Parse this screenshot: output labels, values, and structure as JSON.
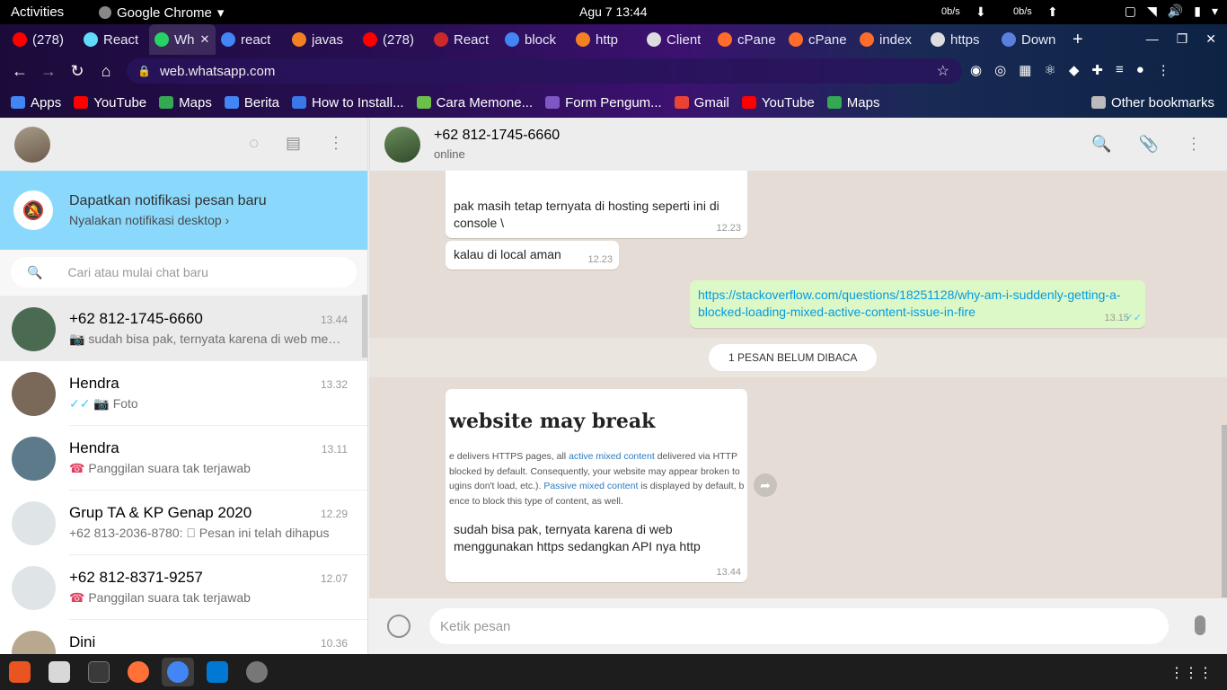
{
  "topbar": {
    "activities": "Activities",
    "app_name": "Google Chrome",
    "clock": "Agu 7  13:44",
    "net_down": "0b/s",
    "net_up": "0b/s"
  },
  "chrome": {
    "tabs": [
      {
        "label": "(278)",
        "color": "#ff0000"
      },
      {
        "label": "React",
        "color": "#61dafb"
      },
      {
        "label": "Wh",
        "color": "#25d366",
        "active": true
      },
      {
        "label": "react",
        "color": "#4285f4"
      },
      {
        "label": "javas",
        "color": "#f48024"
      },
      {
        "label": "(278)",
        "color": "#ff0000"
      },
      {
        "label": "React",
        "color": "#cc2a2a"
      },
      {
        "label": "block",
        "color": "#4285f4"
      },
      {
        "label": "http",
        "color": "#f48024"
      },
      {
        "label": "Client",
        "color": "#dddddd"
      },
      {
        "label": "cPane",
        "color": "#ff6c2c"
      },
      {
        "label": "cPane",
        "color": "#ff6c2c"
      },
      {
        "label": "index",
        "color": "#ff6c2c"
      },
      {
        "label": "https",
        "color": "#dddddd"
      },
      {
        "label": "Down",
        "color": "#5a7fdc"
      }
    ],
    "url": "web.whatsapp.com",
    "bookmarks": [
      {
        "label": "Apps",
        "color": "#4285f4"
      },
      {
        "label": "YouTube",
        "color": "#ff0000"
      },
      {
        "label": "Maps",
        "color": "#34a853"
      },
      {
        "label": "Berita",
        "color": "#4285f4"
      },
      {
        "label": "How to Install...",
        "color": "#3b78e7"
      },
      {
        "label": "Cara Memone...",
        "color": "#6cc04a"
      },
      {
        "label": "Form Pengum...",
        "color": "#7e57c2"
      },
      {
        "label": "Gmail",
        "color": "#ea4335"
      },
      {
        "label": "YouTube",
        "color": "#ff0000"
      },
      {
        "label": "Maps",
        "color": "#34a853"
      }
    ],
    "other_bookmarks": "Other bookmarks"
  },
  "sidebar": {
    "notif_title": "Dapatkan notifikasi pesan baru",
    "notif_sub": "Nyalakan notifikasi desktop ›",
    "search_placeholder": "Cari atau mulai chat baru",
    "chats": [
      {
        "name": "+62 812-1745-6660",
        "time": "13.44",
        "prefix": "📷 ",
        "last": "sudah bisa pak, ternyata karena di web menggunakan https sedangkan API nya http",
        "active": true,
        "avatar_color": "#4a6a52"
      },
      {
        "name": "Hendra",
        "time": "13.32",
        "ticks": "✓✓ ",
        "prefix": "📷 ",
        "last": "Foto",
        "avatar_color": "#7a6858"
      },
      {
        "name": "Hendra",
        "time": "13.11",
        "missed": "☎ ",
        "last": "Panggilan suara tak terjawab",
        "avatar_color": "#5c7a8a"
      },
      {
        "name": "Grup TA & KP Genap 2020",
        "time": "12.29",
        "last": "+62 813-2036-8780: ⃠ Pesan ini telah dihapus",
        "avatar_color": "#dfe5e7"
      },
      {
        "name": "+62 812-8371-9257",
        "time": "12.07",
        "missed": "☎ ",
        "last": "Panggilan suara tak terjawab",
        "avatar_color": "#dfe5e7"
      },
      {
        "name": "Dini",
        "time": "10.36",
        "last": "",
        "avatar_color": "#b8a890"
      }
    ]
  },
  "conversation": {
    "contact_name": "+62 812-1745-6660",
    "status": "online",
    "messages": [
      {
        "text1": "pak masih tetap ternyata di hosting seperti ini di",
        "text2": "console \\",
        "time": "12.23"
      },
      {
        "text": "kalau di local aman",
        "time": "12.23"
      },
      {
        "link1": "https://stackoverflow.com/questions/18251128/why-am-i-suddenly-getting-a-",
        "link2": "blocked-loading-mixed-active-content-issue-in-fire",
        "time": "13.15",
        "ticks": "✓✓"
      },
      {
        "caption1": "sudah bisa pak, ternyata karena di web",
        "caption2": "menggunakan https sedangkan API nya http",
        "time": "13.44"
      }
    ],
    "unread_label": "1 PESAN BELUM DIBACA",
    "preview": {
      "heading": "website may break",
      "l1a": "e delivers HTTPS pages, all ",
      "l1b": "active mixed content",
      "l1c": " delivered via HTTP",
      "l2": " blocked by default. Consequently, your website may appear broken to",
      "l3a": "ugins don't load, etc.). ",
      "l3b": "Passive mixed content",
      "l3c": " is displayed by default, b",
      "l4": "ence to block this type of content, as well."
    },
    "composer_placeholder": "Ketik pesan"
  }
}
